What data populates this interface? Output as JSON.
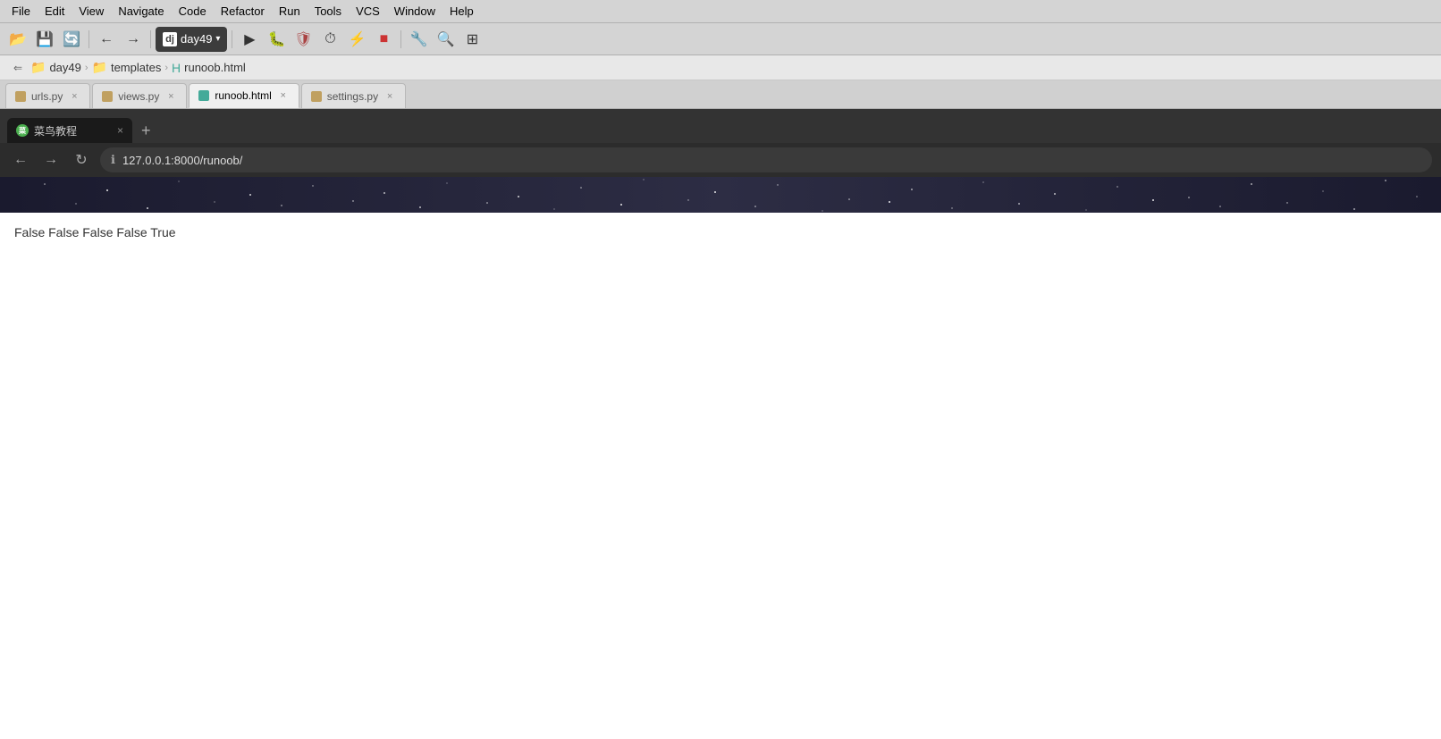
{
  "menu": {
    "items": [
      "File",
      "Edit",
      "View",
      "Navigate",
      "Code",
      "Refactor",
      "Run",
      "Tools",
      "VCS",
      "Window",
      "Help"
    ]
  },
  "toolbar": {
    "project_name": "day49",
    "dropdown_arrow": "▾"
  },
  "breadcrumb": {
    "items": [
      {
        "label": "day49",
        "type": "folder"
      },
      {
        "label": "templates",
        "type": "folder"
      },
      {
        "label": "runoob.html",
        "type": "html"
      }
    ]
  },
  "editor_tabs": [
    {
      "id": "urls",
      "label": "urls.py",
      "color": "#c0a060",
      "active": false
    },
    {
      "id": "views",
      "label": "views.py",
      "color": "#c0a060",
      "active": false
    },
    {
      "id": "runoob",
      "label": "runoob.html",
      "color": "#4a9",
      "active": true
    },
    {
      "id": "settings",
      "label": "settings.py",
      "color": "#c0a060",
      "active": false
    }
  ],
  "browser": {
    "tab_label": "菜鸟教程",
    "url": "127.0.0.1:8000/runoob/",
    "url_display": "127.0.0.1:8000/runoob/"
  },
  "page_content": {
    "text": "False False False False True"
  }
}
